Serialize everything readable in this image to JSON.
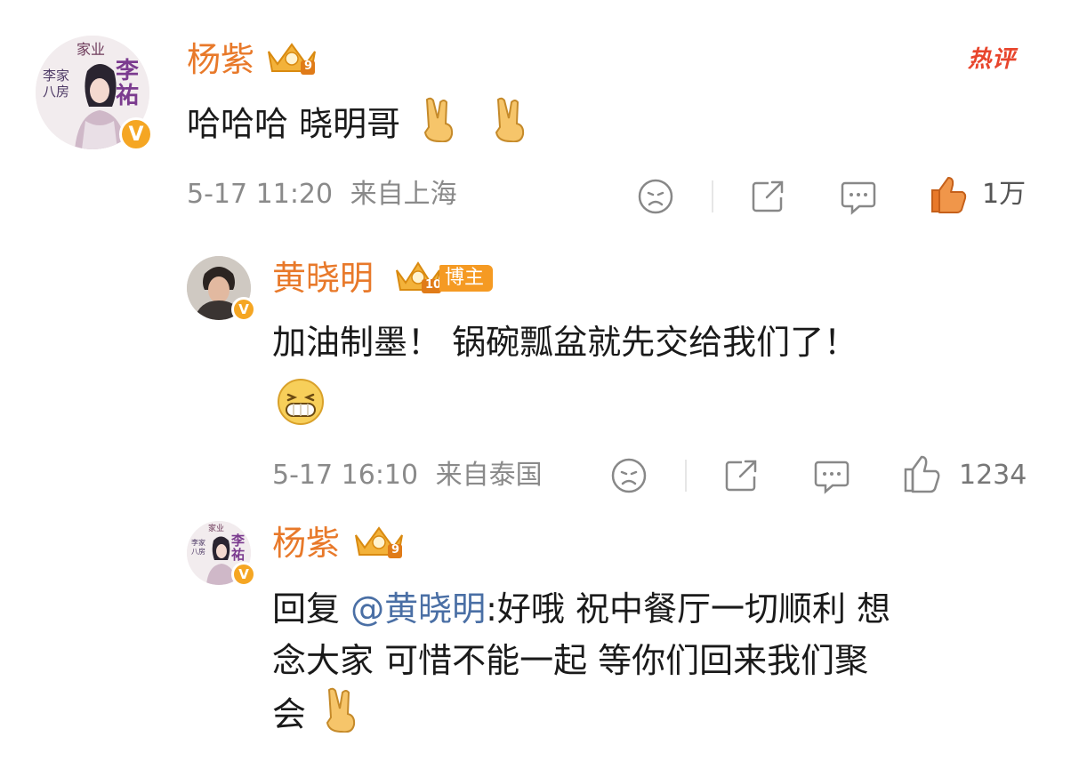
{
  "comment1": {
    "author": "杨紫",
    "level": "9",
    "hot_tag": "热评",
    "text": "哈哈哈 晓明哥",
    "emojis": [
      "victory-hand",
      "victory-hand"
    ],
    "date": "5-17",
    "time": "11:20",
    "location": "来自上海",
    "likes": "1万",
    "avatar_text": {
      "top": "家业",
      "name": "李祐",
      "side": "李家八房"
    }
  },
  "reply1": {
    "author": "黄晓明",
    "level": "10",
    "badge": "博主",
    "text": "加油制墨！ 锅碗瓢盆就先交给我们了！",
    "emojis": [
      "grin-face"
    ],
    "date": "5-17",
    "time": "16:10",
    "location": "来自泰国",
    "likes": "1234"
  },
  "reply2": {
    "author": "杨紫",
    "level": "9",
    "prefix": "回复",
    "mention": "@黄晓明",
    "line1": ":好哦 祝中餐厅一切顺利 想",
    "line2": "念大家 可惜不能一起 等你们回来我们聚",
    "line3": "会",
    "emojis": [
      "victory-hand"
    ],
    "avatar_text": {
      "top": "家业",
      "name": "李祐",
      "side": "李家八房"
    }
  },
  "colors": {
    "name": "#e8792a",
    "hot": "#e8452c",
    "badge": "#f59a23",
    "mention": "#4a6fa5",
    "meta": "#8a8a8a",
    "like_active": "#e8792a"
  },
  "icons": [
    "dislike-face-icon",
    "share-icon",
    "comment-icon",
    "like-thumb-icon",
    "crown-level-icon",
    "verified-v-icon"
  ]
}
